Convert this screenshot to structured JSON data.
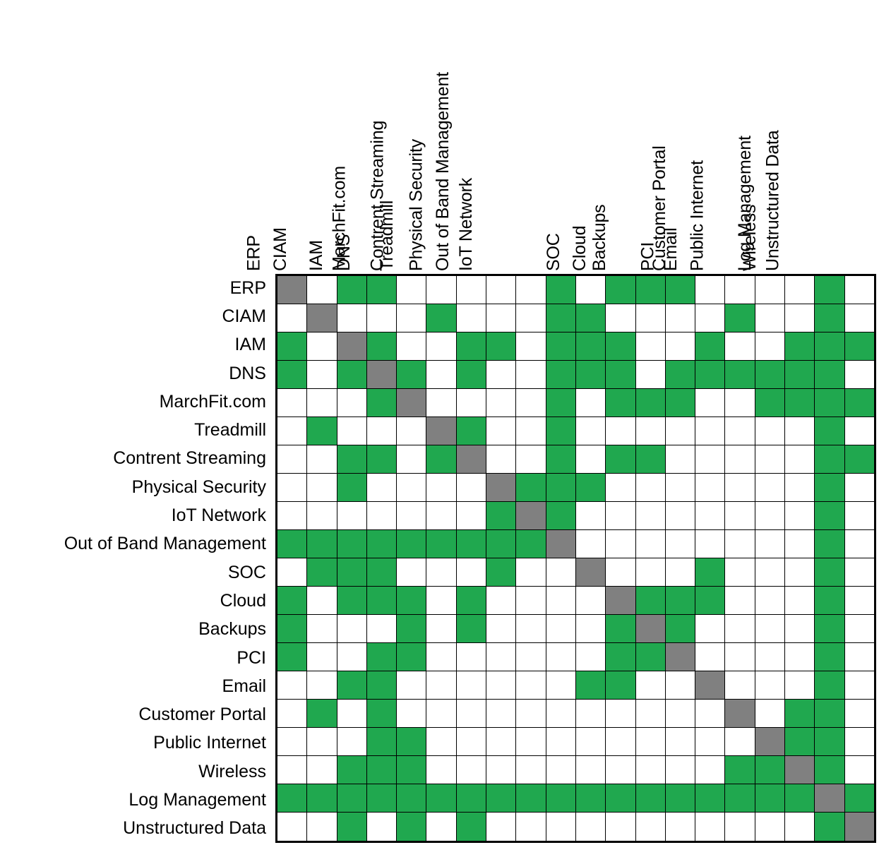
{
  "chart_data": {
    "type": "heatmap",
    "title": "",
    "xlabel": "",
    "ylabel": "",
    "legend": [],
    "grid": true,
    "colors": {
      "related": "#20a84f",
      "self": "#808080",
      "none": "#ffffff",
      "border": "#000000"
    },
    "value_meaning": {
      "1": "related / connected",
      "0": "not related",
      "2": "self (diagonal)"
    },
    "categories": [
      "ERP",
      "CIAM",
      "IAM",
      "DNS",
      "MarchFit.com",
      "Treadmill",
      "Contrent Streaming",
      "Physical Security",
      "IoT Network",
      "Out of Band Management",
      "SOC",
      "Cloud",
      "Backups",
      "PCI",
      "Email",
      "Customer Portal",
      "Public Internet",
      "Wireless",
      "Log Management",
      "Unstructured Data"
    ],
    "row_labels": [
      "ERP",
      "CIAM",
      "IAM",
      "DNS",
      "MarchFit.com",
      "Treadmill",
      "Contrent Streaming",
      "Physical Security",
      "IoT Network",
      "Out of Band Management",
      "SOC",
      "Cloud",
      "Backups",
      "PCI",
      "Email",
      "Customer Portal",
      "Public Internet",
      "Wireless",
      "Log Management",
      "Unstructured Data"
    ],
    "column_labels": [
      "ERP",
      "CIAM",
      "IAM",
      "DNS",
      "MarchFit.com",
      "Treadmill",
      "Contrent Streaming",
      "Physical Security",
      "IoT Network",
      "Out of Band Management",
      "SOC",
      "Cloud",
      "Backups",
      "PCI",
      "Email",
      "Customer Portal",
      "Public Internet",
      "Wireless",
      "Log Management",
      "Unstructured Data"
    ],
    "values": [
      [
        2,
        0,
        1,
        1,
        0,
        0,
        0,
        0,
        0,
        1,
        0,
        1,
        1,
        1,
        0,
        0,
        0,
        0,
        1,
        0
      ],
      [
        0,
        2,
        0,
        0,
        0,
        1,
        0,
        0,
        0,
        1,
        1,
        0,
        0,
        0,
        0,
        1,
        0,
        0,
        1,
        0
      ],
      [
        1,
        0,
        2,
        1,
        0,
        0,
        1,
        1,
        0,
        1,
        1,
        1,
        0,
        0,
        1,
        0,
        0,
        1,
        1,
        1
      ],
      [
        1,
        0,
        1,
        2,
        1,
        0,
        1,
        0,
        0,
        1,
        1,
        1,
        0,
        1,
        1,
        1,
        1,
        1,
        1,
        0
      ],
      [
        0,
        0,
        0,
        1,
        2,
        0,
        0,
        0,
        0,
        1,
        0,
        1,
        1,
        1,
        0,
        0,
        1,
        1,
        1,
        1
      ],
      [
        0,
        1,
        0,
        0,
        0,
        2,
        1,
        0,
        0,
        1,
        0,
        0,
        0,
        0,
        0,
        0,
        0,
        0,
        1,
        0
      ],
      [
        0,
        0,
        1,
        1,
        0,
        1,
        2,
        0,
        0,
        1,
        0,
        1,
        1,
        0,
        0,
        0,
        0,
        0,
        1,
        1
      ],
      [
        0,
        0,
        1,
        0,
        0,
        0,
        0,
        2,
        1,
        1,
        1,
        0,
        0,
        0,
        0,
        0,
        0,
        0,
        1,
        0
      ],
      [
        0,
        0,
        0,
        0,
        0,
        0,
        0,
        1,
        2,
        1,
        0,
        0,
        0,
        0,
        0,
        0,
        0,
        0,
        1,
        0
      ],
      [
        1,
        1,
        1,
        1,
        1,
        1,
        1,
        1,
        1,
        2,
        0,
        0,
        0,
        0,
        0,
        0,
        0,
        0,
        1,
        0
      ],
      [
        0,
        1,
        1,
        1,
        0,
        0,
        0,
        1,
        0,
        0,
        2,
        0,
        0,
        0,
        1,
        0,
        0,
        0,
        1,
        0
      ],
      [
        1,
        0,
        1,
        1,
        1,
        0,
        1,
        0,
        0,
        0,
        0,
        2,
        1,
        1,
        1,
        0,
        0,
        0,
        1,
        0
      ],
      [
        1,
        0,
        0,
        0,
        1,
        0,
        1,
        0,
        0,
        0,
        0,
        1,
        2,
        1,
        0,
        0,
        0,
        0,
        1,
        0
      ],
      [
        1,
        0,
        0,
        1,
        1,
        0,
        0,
        0,
        0,
        0,
        0,
        1,
        1,
        2,
        0,
        0,
        0,
        0,
        1,
        0
      ],
      [
        0,
        0,
        1,
        1,
        0,
        0,
        0,
        0,
        0,
        0,
        1,
        1,
        0,
        0,
        2,
        0,
        0,
        0,
        1,
        0
      ],
      [
        0,
        1,
        0,
        1,
        0,
        0,
        0,
        0,
        0,
        0,
        0,
        0,
        0,
        0,
        0,
        2,
        0,
        1,
        1,
        0
      ],
      [
        0,
        0,
        0,
        1,
        1,
        0,
        0,
        0,
        0,
        0,
        0,
        0,
        0,
        0,
        0,
        0,
        2,
        1,
        1,
        0
      ],
      [
        0,
        0,
        1,
        1,
        1,
        0,
        0,
        0,
        0,
        0,
        0,
        0,
        0,
        0,
        0,
        1,
        1,
        2,
        1,
        0
      ],
      [
        1,
        1,
        1,
        1,
        1,
        1,
        1,
        1,
        1,
        1,
        1,
        1,
        1,
        1,
        1,
        1,
        1,
        1,
        2,
        1
      ],
      [
        0,
        0,
        1,
        0,
        1,
        0,
        1,
        0,
        0,
        0,
        0,
        0,
        0,
        0,
        0,
        0,
        0,
        0,
        1,
        2
      ]
    ]
  }
}
